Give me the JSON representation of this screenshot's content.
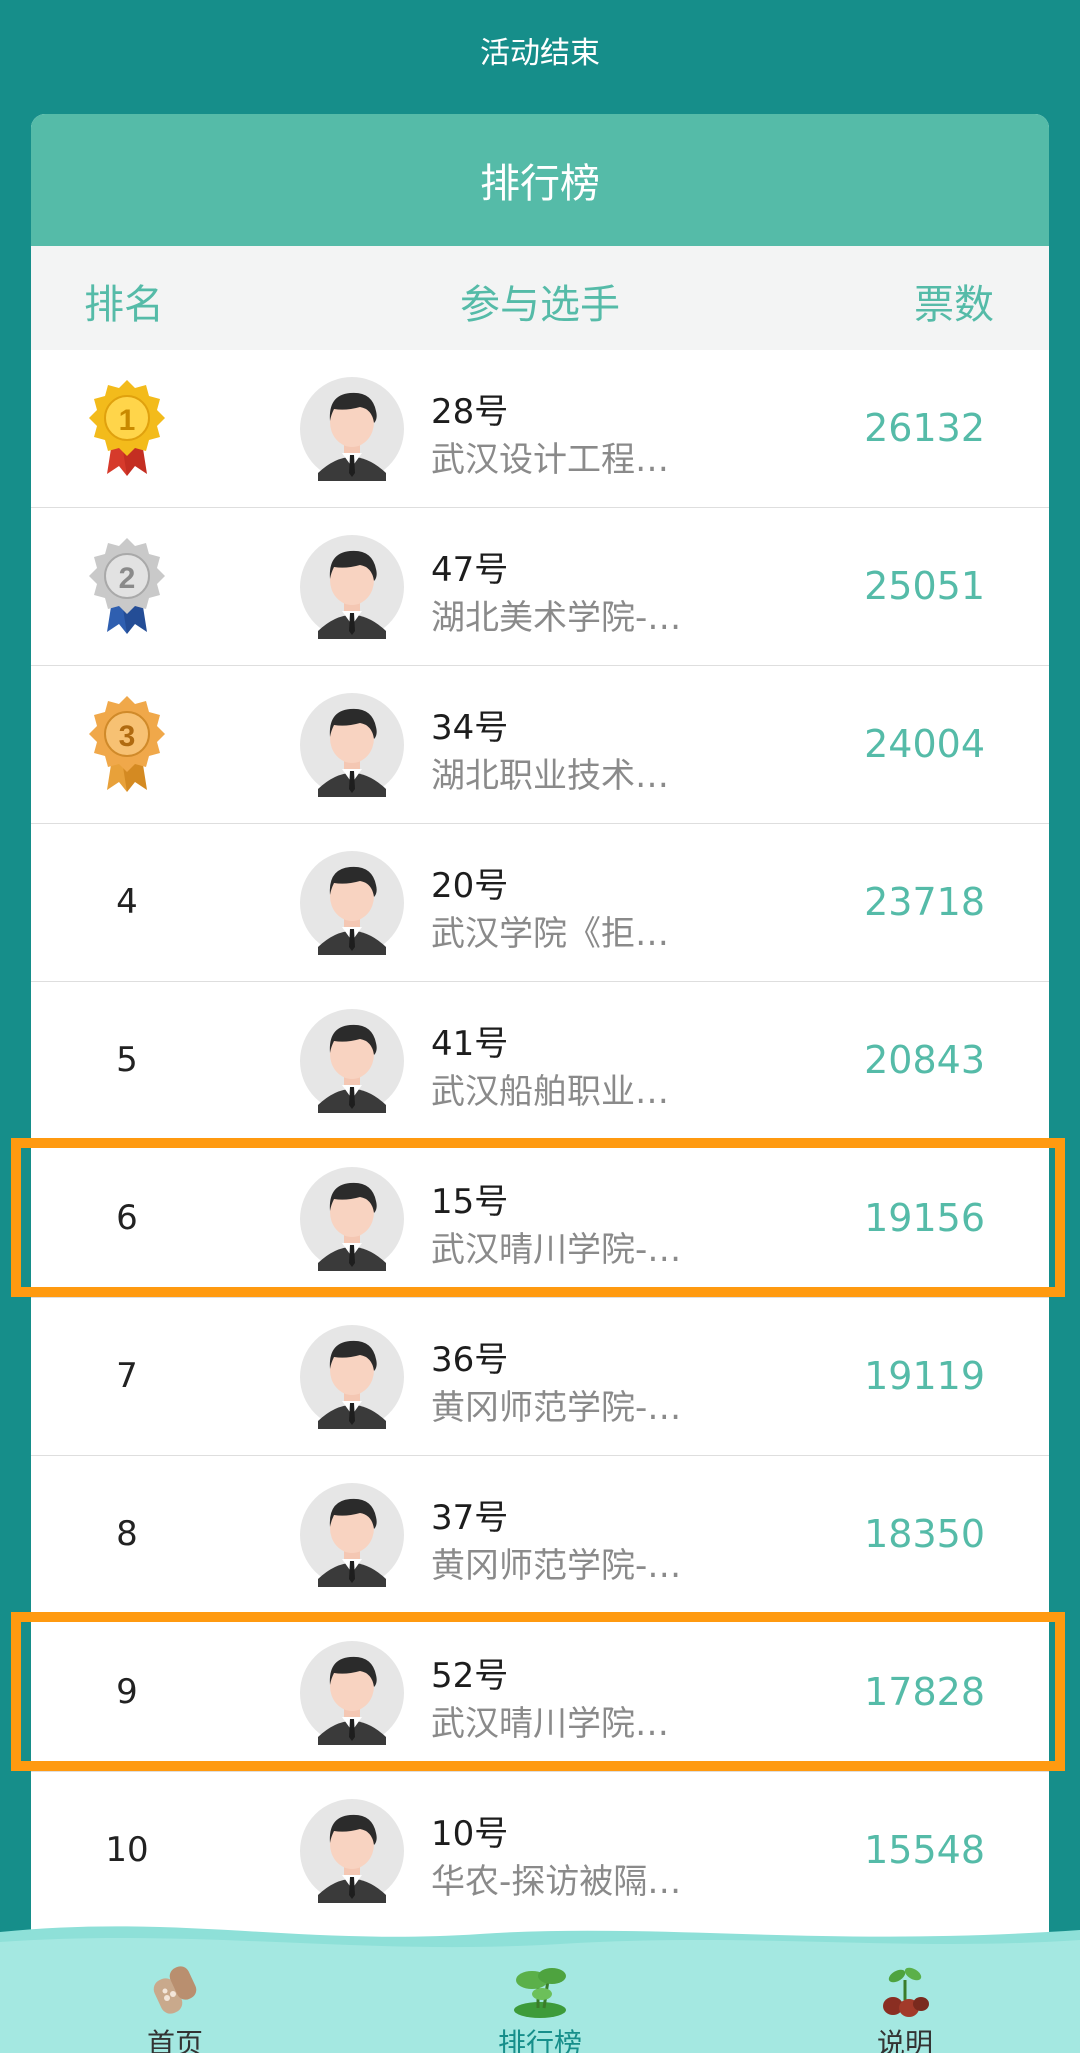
{
  "header": {
    "title": "活动结束"
  },
  "card": {
    "title": "排行榜",
    "columns": {
      "rank": "排名",
      "player": "参与选手",
      "votes": "票数"
    }
  },
  "rows": [
    {
      "rank": "1",
      "medal": "gold-medal-icon",
      "name": "28号",
      "school": "武汉设计工程…",
      "votes": "26132"
    },
    {
      "rank": "2",
      "medal": "silver-medal-icon",
      "name": "47号",
      "school": "湖北美术学院-…",
      "votes": "25051"
    },
    {
      "rank": "3",
      "medal": "bronze-medal-icon",
      "name": "34号",
      "school": "湖北职业技术…",
      "votes": "24004"
    },
    {
      "rank": "4",
      "name": "20号",
      "school": "武汉学院《拒…",
      "votes": "23718"
    },
    {
      "rank": "5",
      "name": "41号",
      "school": "武汉船舶职业…",
      "votes": "20843"
    },
    {
      "rank": "6",
      "name": "15号",
      "school": "武汉晴川学院-…",
      "votes": "19156",
      "highlighted": true
    },
    {
      "rank": "7",
      "name": "36号",
      "school": "黄冈师范学院-…",
      "votes": "19119"
    },
    {
      "rank": "8",
      "name": "37号",
      "school": "黄冈师范学院-…",
      "votes": "18350"
    },
    {
      "rank": "9",
      "name": "52号",
      "school": "武汉晴川学院…",
      "votes": "17828",
      "highlighted": true
    },
    {
      "rank": "10",
      "name": "10号",
      "school": "华农-探访被隔…",
      "votes": "15548"
    }
  ],
  "nav": {
    "home": {
      "label": "首页",
      "icon": "lotus-root-icon"
    },
    "ranking": {
      "label": "排行榜",
      "icon": "lotus-leaf-icon",
      "active": true
    },
    "info": {
      "label": "说明",
      "icon": "seedling-icon"
    }
  },
  "colors": {
    "background": "#168e8a",
    "accent": "#55bba8",
    "highlight_border": "#ff9a10",
    "wave": "#8ee0d8"
  }
}
